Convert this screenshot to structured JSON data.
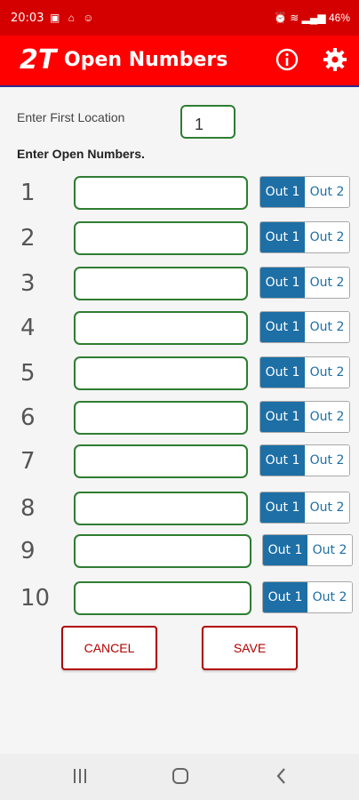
{
  "status_bar": {
    "time": "20:03",
    "battery": "46%"
  },
  "app": {
    "logo": "2T",
    "title": "Open Numbers"
  },
  "first_location": {
    "label": "Enter First Location",
    "value": "1"
  },
  "open_numbers_label": "Enter Open Numbers.",
  "rows": [
    {
      "number": "1",
      "selected": "Out 1",
      "other": "Out 2"
    },
    {
      "number": "2",
      "selected": "Out 1",
      "other": "Out 2"
    },
    {
      "number": "3",
      "selected": "Out 1",
      "other": "Out 2"
    },
    {
      "number": "4",
      "selected": "Out 1",
      "other": "Out 2"
    },
    {
      "number": "5",
      "selected": "Out 1",
      "other": "Out 2"
    },
    {
      "number": "6",
      "selected": "Out 1",
      "other": "Out 2"
    },
    {
      "number": "7",
      "selected": "Out 1",
      "other": "Out 2"
    },
    {
      "number": "8",
      "selected": "Out 1",
      "other": "Out 2"
    },
    {
      "number": "9",
      "selected": "Out 1",
      "other": "Out 2"
    },
    {
      "number": "10",
      "selected": "Out 1",
      "other": "Out 2"
    }
  ],
  "buttons": {
    "cancel": "CANCEL",
    "save": "SAVE"
  },
  "colors": {
    "appbar": "#ff0000",
    "field_border": "#2e7d32",
    "toggle_selected": "#1d6fa5",
    "button_border": "#b00000"
  }
}
